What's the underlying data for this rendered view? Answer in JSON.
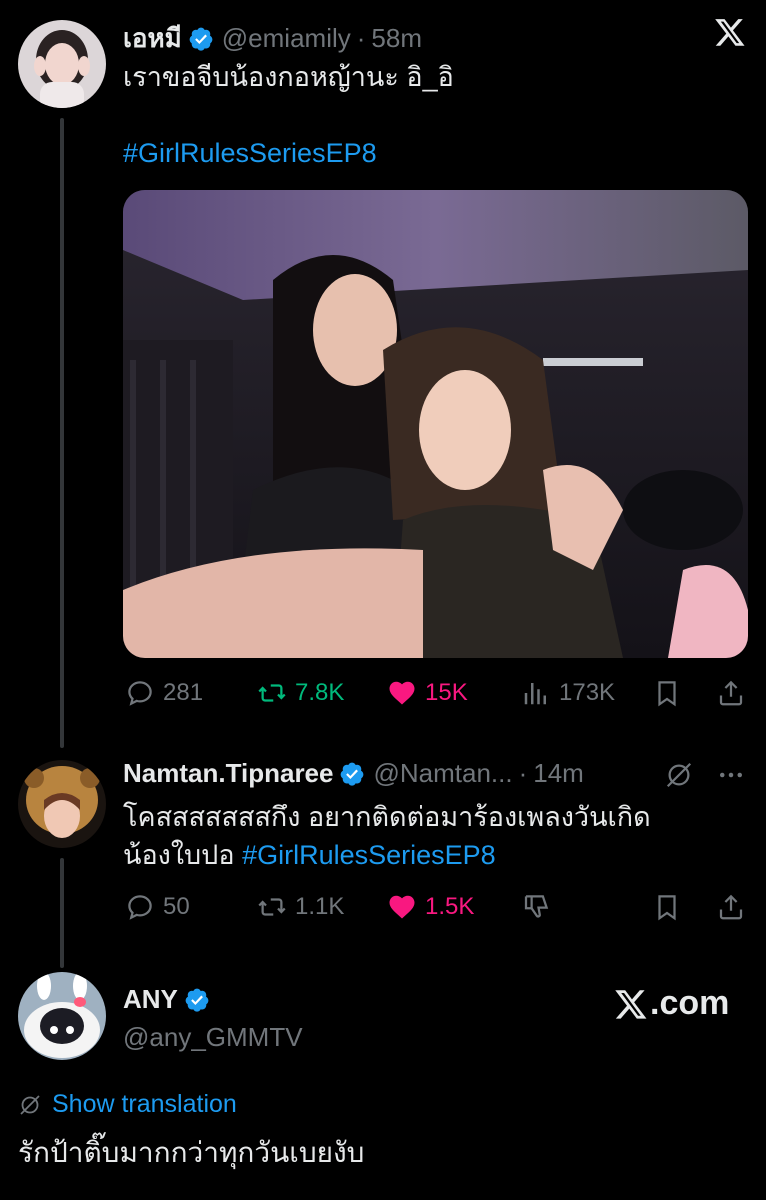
{
  "tweet1": {
    "display_name": "เอหมี",
    "handle": "@emiamily",
    "separator": "·",
    "time": "58m",
    "text": "เราขอจีบน้องกอหญ้านะ อิ_อิ",
    "hashtag": "#GirlRulesSeriesEP8",
    "stats": {
      "replies": "281",
      "reposts": "7.8K",
      "likes": "15K",
      "views": "173K"
    }
  },
  "tweet2": {
    "display_name": "Namtan.Tipnaree",
    "handle": "@Namtan...",
    "separator": "·",
    "time": "14m",
    "text_line1": "โคสสสสสสสกึง อยากติดต่อมาร้องเพลงวันเกิด",
    "text_line2": "น้องใบปอ",
    "hashtag": "#GirlRulesSeriesEP8",
    "stats": {
      "replies": "50",
      "reposts": "1.1K",
      "likes": "1.5K"
    }
  },
  "tweet3": {
    "display_name": "ANY",
    "handle": "@any_GMMTV",
    "brand": "X.com",
    "show_translation": "Show translation",
    "text": "รักป้าติ๊บมากกว่าทุกวันเบยงับ"
  },
  "colors": {
    "background": "#000000",
    "text": "#e7e9ea",
    "muted": "#71767b",
    "link": "#1d9bf0",
    "like": "#f91880",
    "repost": "#00ba7c"
  },
  "icons": [
    "x-logo-icon",
    "verified-badge-icon",
    "reply-icon",
    "repost-icon",
    "like-icon",
    "views-icon",
    "bookmark-icon",
    "share-icon",
    "grok-icon",
    "more-icon",
    "globe-icon"
  ]
}
